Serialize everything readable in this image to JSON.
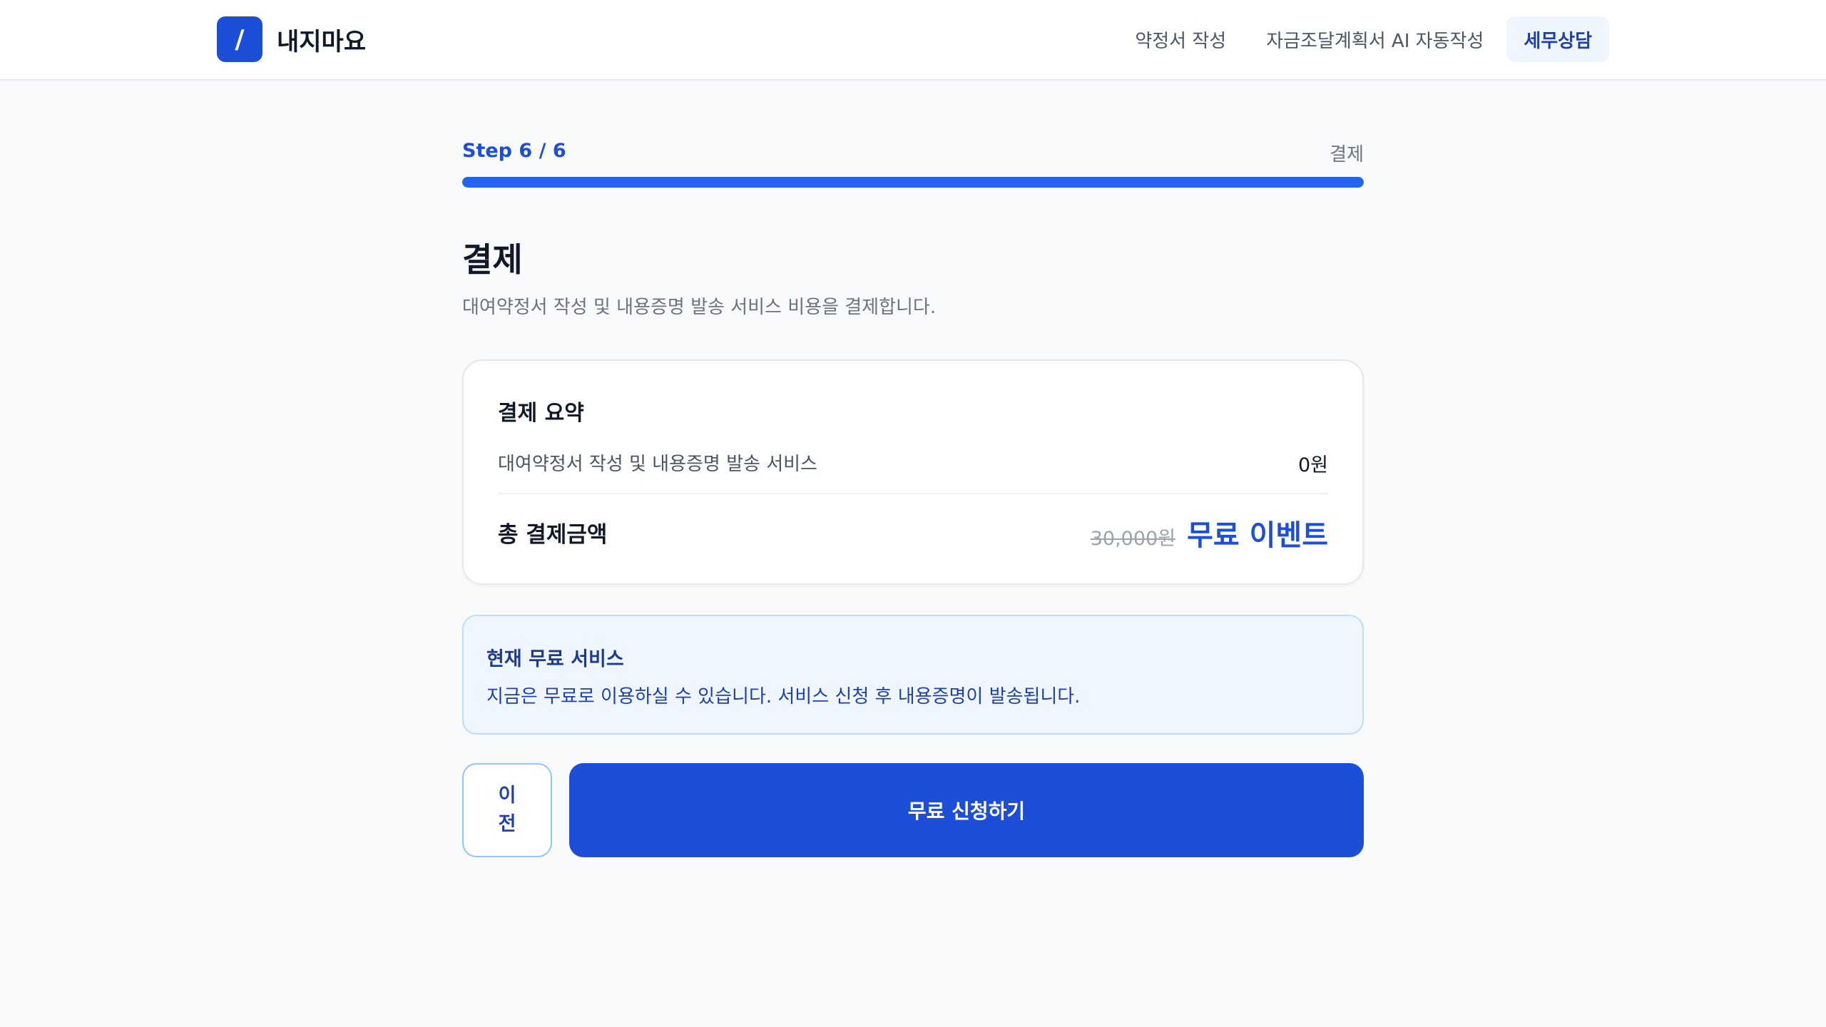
{
  "header": {
    "logo_mark": "/",
    "logo_text": "내지마요",
    "nav": [
      {
        "label": "약정서 작성"
      },
      {
        "label": "자금조달계획서 AI 자동작성"
      },
      {
        "label": "세무상담",
        "active": true
      }
    ]
  },
  "step": {
    "label": "Step 6 / 6",
    "name": "결제",
    "current": 6,
    "total": 6,
    "progress_fraction": 1.0
  },
  "page": {
    "title": "결제",
    "description": "대여약정서 작성 및 내용증명 발송 서비스 비용을 결제합니다."
  },
  "summary": {
    "title": "결제 요약",
    "line_label": "대여약정서 작성 및 내용증명 발송 서비스",
    "line_value": "0원",
    "total_label": "총 결제금액",
    "original_price": "30,000원",
    "event_label": "무료 이벤트"
  },
  "notice": {
    "title": "현재 무료 서비스",
    "text": "지금은 무료로 이용하실 수 있습니다. 서비스 신청 후 내용증명이 발송됩니다."
  },
  "buttons": {
    "prev_label": "이전",
    "submit_label": "무료 신청하기"
  },
  "colors": {
    "accent": "#1d4ed8",
    "progress": "#2563eb",
    "background": "#f8fafc",
    "notice_bg": "#eff6ff"
  }
}
